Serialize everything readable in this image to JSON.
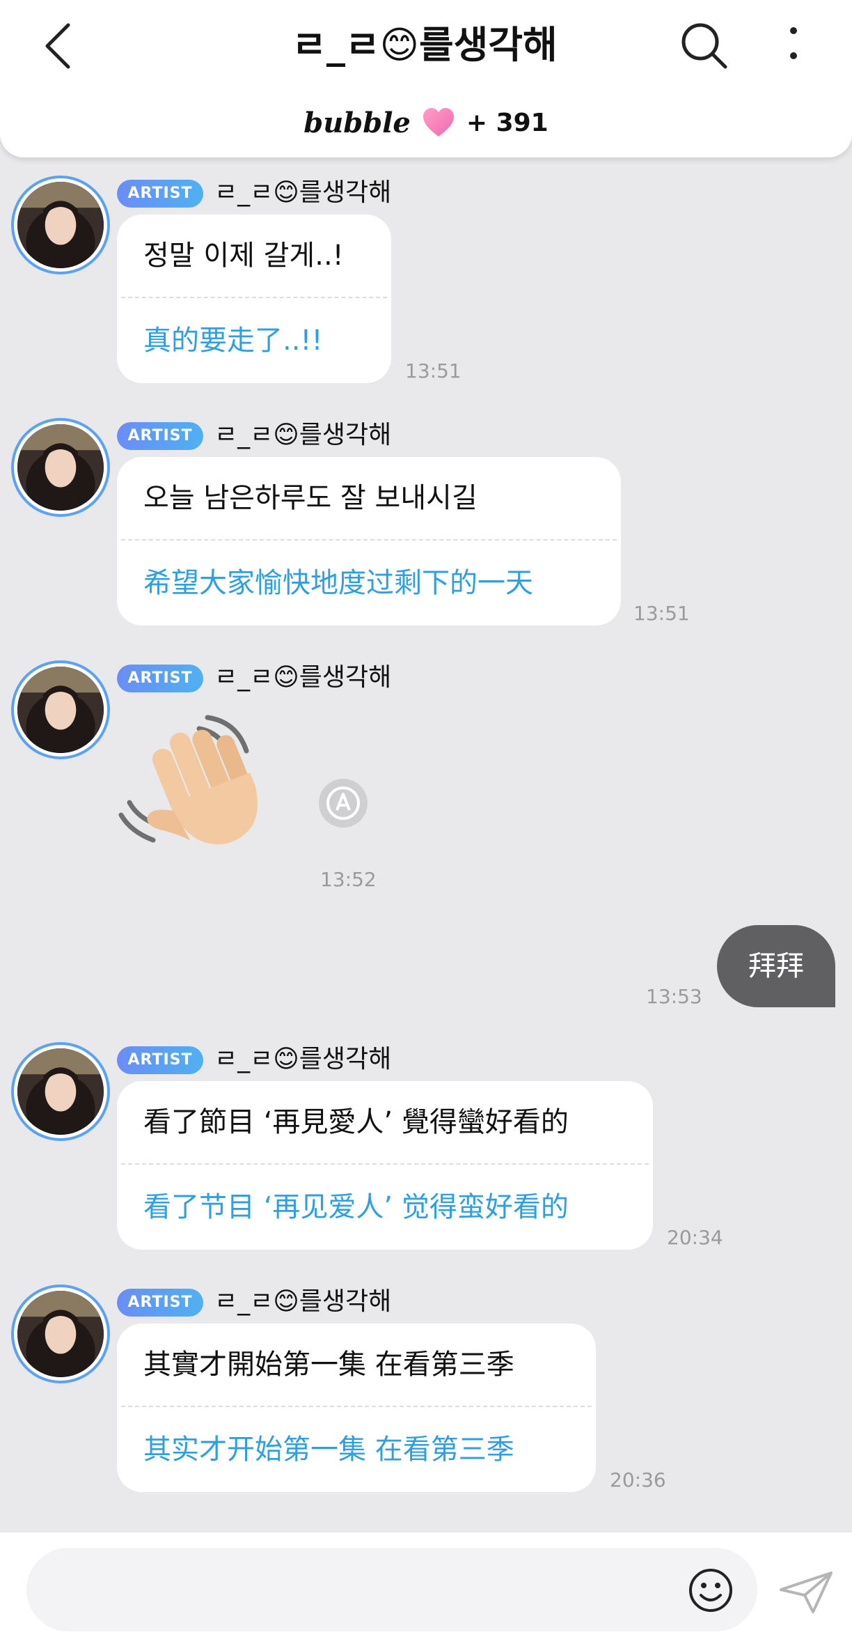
{
  "header": {
    "title": "ㄹ_ㄹ😊를생각해",
    "bubble_logo": "bubble",
    "bubble_count": "+ 391"
  },
  "messages": [
    {
      "badge": "ARTIST",
      "name": "ㄹ_ㄹ😊를생각해",
      "original": "정말 이제 갈게..!",
      "translation": "真的要走了..!!",
      "time": "13:51"
    },
    {
      "badge": "ARTIST",
      "name": "ㄹ_ㄹ😊를생각해",
      "original": "오늘 남은하루도 잘 보내시길",
      "translation": "希望大家愉快地度过剩下的一天",
      "time": "13:51"
    },
    {
      "badge": "ARTIST",
      "name": "ㄹ_ㄹ😊를생각해",
      "emoji": "waving-hand",
      "time": "13:52"
    },
    {
      "badge": "ARTIST",
      "name": "ㄹ_ㄹ😊를생각해",
      "original": "看了節目 ‘再見愛人’ 覺得蠻好看的",
      "translation": "看了节目 ‘再见爱人’ 觉得蛮好看的",
      "time": "20:34"
    },
    {
      "badge": "ARTIST",
      "name": "ㄹ_ㄹ😊를생각해",
      "original": "其實才開始第一集 在看第三季",
      "translation": "其实才开始第一集 在看第三季",
      "time": "20:36"
    }
  ],
  "my_message": {
    "text": "拜拜",
    "time": "13:53"
  },
  "input": {
    "placeholder": ""
  },
  "colors": {
    "translation": "#2f9fe0",
    "badge_start": "#6a8df5",
    "badge_end": "#4fb1f2",
    "avatar_ring": "#5ba3f2",
    "my_bubble": "#606062"
  }
}
